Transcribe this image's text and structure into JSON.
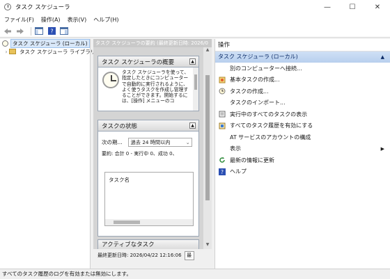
{
  "window": {
    "title": "タスク スケジューラ",
    "controls": {
      "minimize": "—",
      "maximize": "☐",
      "close": "✕"
    }
  },
  "menu": [
    "ファイル(F)",
    "操作(A)",
    "表示(V)",
    "ヘルプ(H)"
  ],
  "toolbar": {
    "icons": [
      "back-arrow-icon",
      "forward-arrow-icon",
      "show-hide-console-tree-icon",
      "help-icon",
      "action-pane-icon"
    ]
  },
  "tree": {
    "root": "タスク スケジューラ (ローカル)",
    "library": "タスク スケジューラ ライブラリ"
  },
  "middle": {
    "header": "タスク スケジューラの要約 (最終更新日時: 2026/0",
    "overview": {
      "title": "タスク スケジューラの概要",
      "text": "タスク スケジューラを使って、指定したときにコンピューターで自動的に実行されるように、よく使うタスクを作成し管理することができます。開始するには、[操作] メニューのコ"
    },
    "status": {
      "title": "タスクの状態",
      "next_label": "次の期...",
      "select_value": "過去 24 時間以内",
      "summary": "要約: 合計 0 - 実行中 0、成功 0、",
      "task_name_label": "タスク名"
    },
    "active_title": "アクティブなタスク",
    "footer_text": "最終更新日時: 2026/04/22 12:16:06",
    "footer_button": "最"
  },
  "actions": {
    "title": "操作",
    "group": "タスク スケジューラ (ローカル)",
    "items": [
      {
        "label": "別のコンピューターへ接続...",
        "icon": ""
      },
      {
        "label": "基本タスクの作成...",
        "icon": "basic-task-icon"
      },
      {
        "label": "タスクの作成...",
        "icon": "create-task-icon"
      },
      {
        "label": "タスクのインポート...",
        "icon": ""
      },
      {
        "label": "実行中のすべてのタスクの表示",
        "icon": "running-tasks-icon"
      },
      {
        "label": "すべてのタスク履歴を有効にする",
        "icon": "enable-history-icon"
      },
      {
        "label": "AT サービスのアカウントの構成",
        "icon": ""
      },
      {
        "label": "表示",
        "icon": "",
        "submenu": "▶"
      },
      {
        "label": "最新の情報に更新",
        "icon": "refresh-icon"
      },
      {
        "label": "ヘルプ",
        "icon": "help-icon"
      }
    ]
  },
  "statusbar": "すべてのタスク履歴のログを有効または無効にします。",
  "colors": {
    "action_group_bg": "#c5d9f1",
    "selected_tree": "#d9e8f9",
    "middle_bg": "#d4d4d4"
  }
}
